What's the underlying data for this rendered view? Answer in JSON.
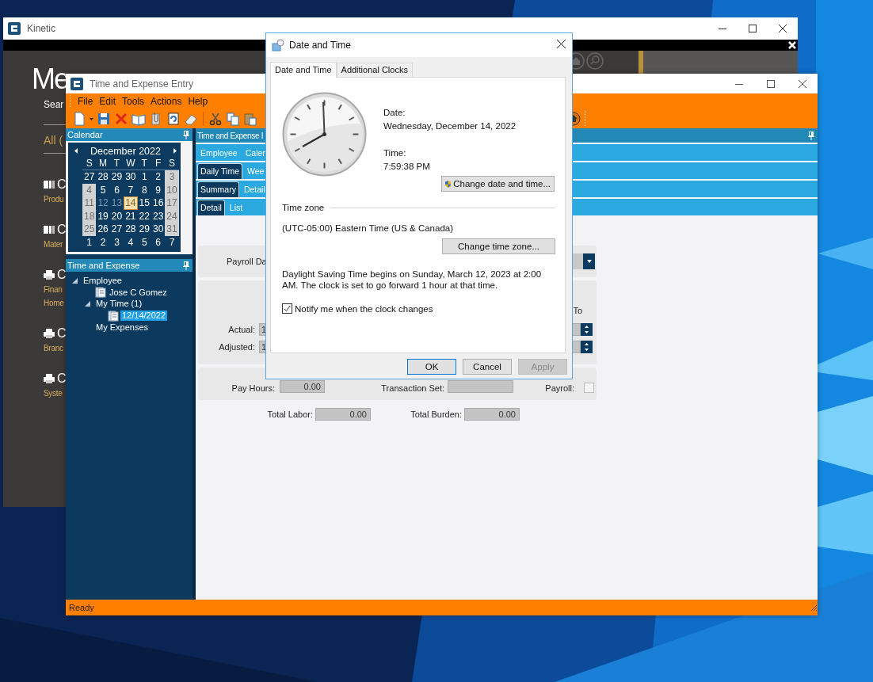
{
  "kinetic": {
    "title": "Kinetic",
    "heading": "Me",
    "search_label": "Sear",
    "filter_label": "All (",
    "tiles": [
      {
        "kind": "book",
        "title": "C",
        "subtitle_lines": [
          "Produ"
        ]
      },
      {
        "kind": "book",
        "title": "C",
        "subtitle_lines": [
          "Mater"
        ]
      },
      {
        "kind": "printer",
        "title": "C",
        "subtitle_lines": [
          "Finan",
          "Home"
        ]
      },
      {
        "kind": "printer",
        "title": "C",
        "subtitle_lines": [
          "Branc"
        ]
      },
      {
        "kind": "printer",
        "title": "C",
        "subtitle_lines": [
          "Syste"
        ]
      }
    ]
  },
  "time_expense": {
    "title": "Time and Expense Entry",
    "menu": [
      "File",
      "Edit",
      "Tools",
      "Actions",
      "Help"
    ],
    "calendar_panel": {
      "title": "Calendar",
      "month": "December 2022",
      "weekdays": [
        "S",
        "M",
        "T",
        "W",
        "T",
        "F",
        "S"
      ],
      "weeks": [
        [
          {
            "day": "27",
            "kind": "plain"
          },
          {
            "day": "28",
            "kind": "plain"
          },
          {
            "day": "29",
            "kind": "plain"
          },
          {
            "day": "30",
            "kind": "plain"
          },
          {
            "day": "1",
            "kind": "plain"
          },
          {
            "day": "2",
            "kind": "plain"
          },
          {
            "day": "3",
            "kind": "weekend"
          }
        ],
        [
          {
            "day": "4",
            "kind": "weekend"
          },
          {
            "day": "5",
            "kind": "plain"
          },
          {
            "day": "6",
            "kind": "plain"
          },
          {
            "day": "7",
            "kind": "plain"
          },
          {
            "day": "8",
            "kind": "plain"
          },
          {
            "day": "9",
            "kind": "plain"
          },
          {
            "day": "10",
            "kind": "weekend"
          }
        ],
        [
          {
            "day": "11",
            "kind": "weekend"
          },
          {
            "day": "12",
            "kind": "dim"
          },
          {
            "day": "13",
            "kind": "dim"
          },
          {
            "day": "14",
            "kind": "today"
          },
          {
            "day": "15",
            "kind": "plain"
          },
          {
            "day": "16",
            "kind": "plain"
          },
          {
            "day": "17",
            "kind": "weekend"
          }
        ],
        [
          {
            "day": "18",
            "kind": "weekend"
          },
          {
            "day": "19",
            "kind": "plain"
          },
          {
            "day": "20",
            "kind": "plain"
          },
          {
            "day": "21",
            "kind": "plain"
          },
          {
            "day": "22",
            "kind": "plain"
          },
          {
            "day": "23",
            "kind": "plain"
          },
          {
            "day": "24",
            "kind": "weekend"
          }
        ],
        [
          {
            "day": "25",
            "kind": "weekend"
          },
          {
            "day": "26",
            "kind": "plain"
          },
          {
            "day": "27",
            "kind": "plain"
          },
          {
            "day": "28",
            "kind": "plain"
          },
          {
            "day": "29",
            "kind": "plain"
          },
          {
            "day": "30",
            "kind": "plain"
          },
          {
            "day": "31",
            "kind": "weekend"
          }
        ],
        [
          {
            "day": "1",
            "kind": "plain"
          },
          {
            "day": "2",
            "kind": "plain"
          },
          {
            "day": "3",
            "kind": "plain"
          },
          {
            "day": "4",
            "kind": "plain"
          },
          {
            "day": "5",
            "kind": "plain"
          },
          {
            "day": "6",
            "kind": "plain"
          },
          {
            "day": "7",
            "kind": "plain"
          }
        ]
      ]
    },
    "tree_panel": {
      "title": "Time and Expense",
      "nodes": [
        {
          "label": "Employee",
          "kind": "group",
          "expanded": true,
          "selected": false,
          "children": [
            {
              "label": "Jose C Gomez",
              "kind": "record",
              "selected": false
            },
            {
              "label": "My Time (1)",
              "kind": "group",
              "expanded": true,
              "selected": false,
              "children": [
                {
                  "label": "12/14/2022",
                  "kind": "record",
                  "selected": true
                }
              ]
            },
            {
              "label": "My Expenses",
              "kind": "group",
              "selected": false
            }
          ]
        }
      ]
    },
    "main": {
      "title": "Time and Expense I",
      "tab_rows": [
        [
          {
            "label": "Employee",
            "selected": false
          },
          {
            "label": "Calen",
            "selected": false
          }
        ],
        [
          {
            "label": "Daily Time",
            "selected": true
          },
          {
            "label": "Wee",
            "selected": false
          }
        ],
        [
          {
            "label": "Summary",
            "selected": true
          },
          {
            "label": "Detail",
            "selected": false
          }
        ],
        [
          {
            "label": "Detail",
            "selected": true
          },
          {
            "label": "List",
            "selected": false
          }
        ]
      ],
      "form": {
        "payroll_date_label": "Payroll Da",
        "to_label": "To",
        "actual_label": "Actual:",
        "actual_value": "1",
        "adjusted_label": "Adjusted:",
        "adjusted_value": "1",
        "pay_hours_label": "Pay Hours:",
        "pay_hours": "0.00",
        "transaction_set_label": "Transaction Set:",
        "payroll_label": "Payroll:",
        "payroll_checked": false,
        "total_labor_label": "Total Labor:",
        "total_labor": "0.00",
        "total_burden_label": "Total Burden:",
        "total_burden": "0.00"
      }
    },
    "status": "Ready"
  },
  "dialog": {
    "title": "Date and Time",
    "tabs": [
      {
        "label": "Date and Time",
        "selected": true
      },
      {
        "label": "Additional Clocks",
        "selected": false
      }
    ],
    "date_label": "Date:",
    "date_value": "Wednesday, December 14, 2022",
    "time_label": "Time:",
    "time_value": "7:59:38 PM",
    "change_datetime": "Change date and time...",
    "timezone_heading": "Time zone",
    "timezone": "(UTC-05:00) Eastern Time (US & Canada)",
    "change_timezone": "Change time zone...",
    "dst_note": "Daylight Saving Time begins on Sunday, March 12, 2023 at 2:00 AM. The clock is set to go forward 1 hour at that time.",
    "notify": {
      "label": "Notify me when the clock changes",
      "checked": true
    },
    "buttons": [
      {
        "label": "OK",
        "kind": "default"
      },
      {
        "label": "Cancel",
        "kind": "normal"
      },
      {
        "label": "Apply",
        "kind": "disabled"
      }
    ]
  }
}
